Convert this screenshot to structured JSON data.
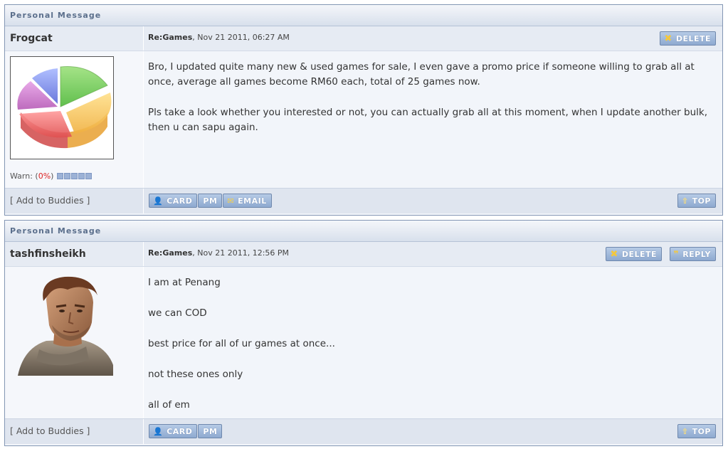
{
  "header_label": "Personal Message",
  "messages": [
    {
      "username": "Frogcat",
      "subject": "Re:Games",
      "date": ", Nov 21 2011, 06:27 AM",
      "avatar_icon": "pie-chart-avatar",
      "warn_label": "Warn: (",
      "warn_pct": "0%",
      "warn_close": ")",
      "paragraphs": [
        "Bro, I updated quite many new & used games for sale, I even gave a promo price if someone willing to grab all at once, average all games become RM60 each, total of 25 games now.",
        "Pls take a look whether you interested or not, you can actually grab all at this moment, when I update another bulk, then u can sapu again."
      ],
      "add_buddies": "[ Add to Buddies ]",
      "buttons_top": {
        "delete": "DELETE"
      },
      "buttons_foot": {
        "card": "CARD",
        "pm": "PM",
        "email": "EMAIL",
        "top": "TOP"
      }
    },
    {
      "username": "tashfinsheikh",
      "subject": "Re:Games",
      "date": ", Nov 21 2011, 12:56 PM",
      "avatar_icon": "character-portrait-avatar",
      "paragraphs": [
        "I am at Penang",
        "we can COD",
        "best price for all of ur games at once...",
        "not these ones only",
        "all of em"
      ],
      "add_buddies": "[ Add to Buddies ]",
      "buttons_top": {
        "delete": "DELETE",
        "reply": "REPLY"
      },
      "buttons_foot": {
        "card": "CARD",
        "pm": "PM",
        "top": "TOP"
      }
    }
  ],
  "icons": {
    "delete": "close-icon",
    "reply": "quote-icon",
    "card": "user-card-icon",
    "email": "envelope-icon",
    "top": "arrow-up-icon"
  },
  "colors": {
    "border": "#8396b4",
    "button": "#8ea9d0",
    "header_text": "#5b6f8c",
    "warn_pct": "#dd2222"
  }
}
